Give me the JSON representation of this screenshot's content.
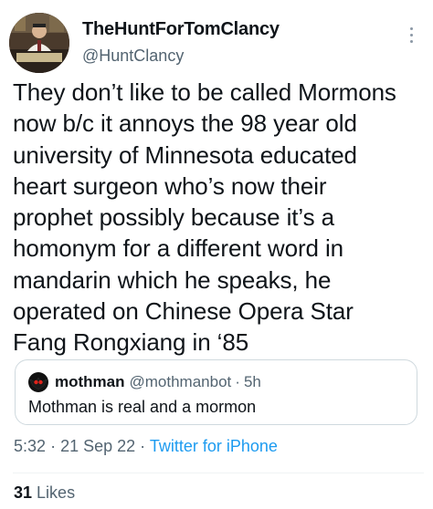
{
  "author": {
    "display_name": "TheHuntForTomClancy",
    "handle": "@HuntClancy"
  },
  "tweet": {
    "lines": [
      "They don’t like to be called Mormons",
      "now b/c it annoys the 98 year old",
      "university of Minnesota educated",
      "heart surgeon who’s now their",
      "prophet possibly because it’s a",
      "homonym for a different word in",
      "mandarin which he speaks, he",
      "operated on Chinese Opera Star",
      "Fang Rongxiang in ‘85"
    ]
  },
  "quote": {
    "display_name": "mothman",
    "handle": "@mothmanbot",
    "separator": "·",
    "time": "5h",
    "text": "Mothman is real and a mormon"
  },
  "meta": {
    "time": "5:32",
    "separator": "·",
    "date": "21 Sep 22",
    "source": "Twitter for iPhone"
  },
  "stats": {
    "likes_count": "31",
    "likes_label": "Likes"
  },
  "icons": {
    "more": "more-vertical-icon"
  },
  "colors": {
    "text": "#0f1419",
    "secondary": "#536471",
    "link": "#1d9bf0",
    "border": "#cfd9de"
  }
}
